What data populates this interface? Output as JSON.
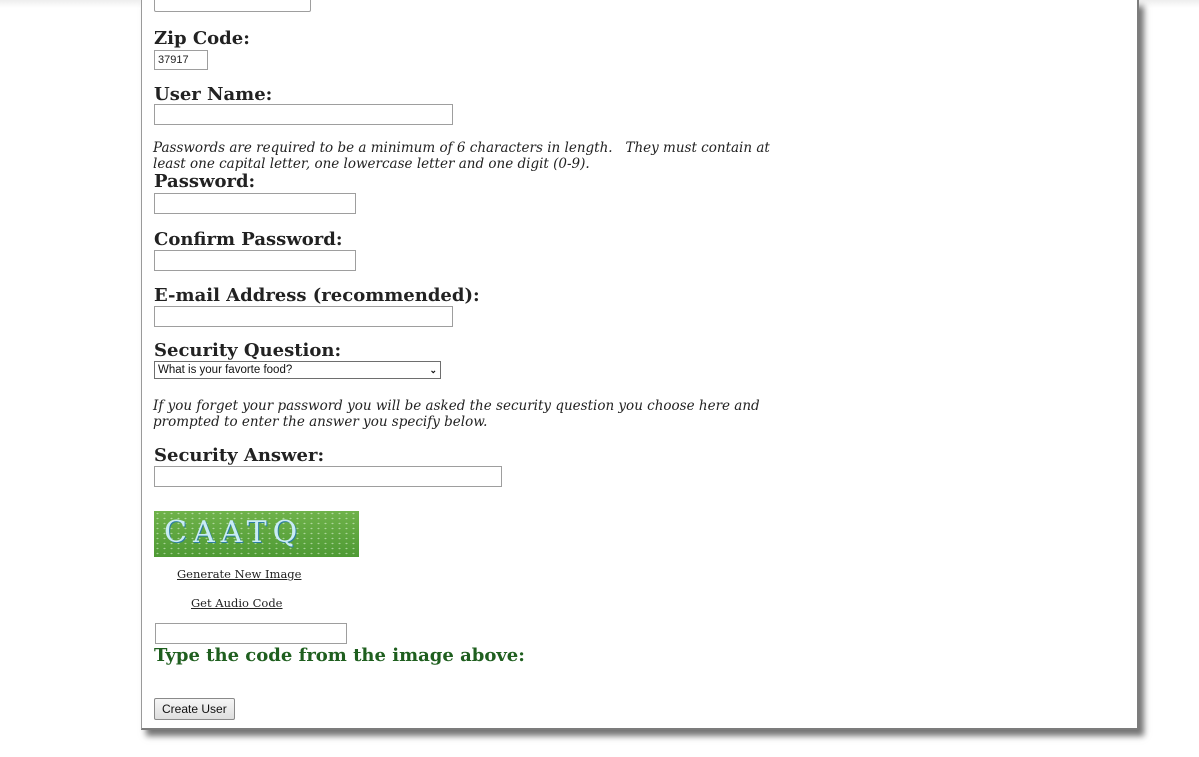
{
  "form": {
    "zip": {
      "label": "Zip Code:",
      "value": "37917"
    },
    "username": {
      "label": "User Name:",
      "value": ""
    },
    "password_note": {
      "line1": "Passwords are required to be a minimum of 6 characters in length.   They must contain at",
      "line2": "least one capital letter, one lowercase letter and one digit (0-9)."
    },
    "password": {
      "label": "Password:",
      "value": ""
    },
    "confirm_password": {
      "label": "Confirm Password:",
      "value": ""
    },
    "email": {
      "label": "E-mail Address (recommended):",
      "value": ""
    },
    "security_question": {
      "label": "Security Question:",
      "selected": "What is your favorte food?",
      "icon": "chevron-down-icon"
    },
    "security_note": {
      "line1": "If you forget your password you will be asked the security question you choose here and",
      "line2": "prompted to enter the answer you specify below."
    },
    "security_answer": {
      "label": "Security Answer:",
      "value": ""
    },
    "captcha": {
      "image_text": "CAATQ",
      "generate_link": "Generate New Image",
      "audio_link": "Get Audio Code",
      "code_value": "",
      "prompt": "Type the code from the image above:"
    },
    "submit_label": "Create User"
  },
  "colors": {
    "prompt_green": "#1f5f1f",
    "captcha_green": "#5aa63e"
  }
}
